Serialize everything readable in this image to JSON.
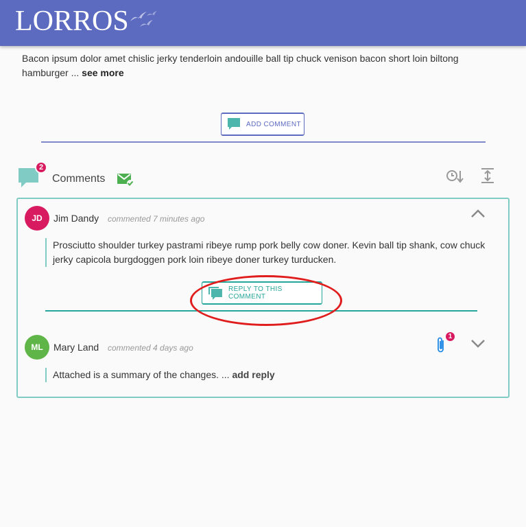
{
  "header": {
    "logo_text": "LORROS",
    "brand_color": "#5c6bc0"
  },
  "intro": {
    "text": "Bacon ipsum dolor amet chislic jerky tenderloin andouille ball tip chuck venison bacon short loin biltong hamburger ... ",
    "see_more": "see more"
  },
  "add_comment": {
    "label": "ADD COMMENT",
    "icon": "comment-icon"
  },
  "comments_section": {
    "title": "Comments",
    "count_badge": "2",
    "icons": [
      "comment-icon",
      "mail-check-icon",
      "sort-by-time-icon",
      "expand-vertical-icon"
    ],
    "accent_color": "#26a69a",
    "badge_color": "#d81b60"
  },
  "comments": [
    {
      "initials": "JD",
      "author": "Jim Dandy",
      "time": "commented 7 minutes ago",
      "body": "Prosciutto shoulder turkey pastrami ribeye rump pork belly cow doner. Kevin ball tip shank, cow chuck jerky capicola burgdoggen pork loin ribeye doner turkey turducken.",
      "avatar_color": "#d81b60",
      "expanded": true,
      "reply_label": "REPLY TO THIS COMMENT"
    },
    {
      "initials": "ML",
      "author": "Mary Land",
      "time": "commented 4 days ago",
      "body": "Attached is a summary of the changes. ... ",
      "add_reply": "add reply",
      "avatar_color": "#5fb548",
      "expanded": false,
      "attachment_count": "1"
    }
  ],
  "annotation": {
    "color": "#e01c1c",
    "target": "reply-to-this-comment-button"
  }
}
